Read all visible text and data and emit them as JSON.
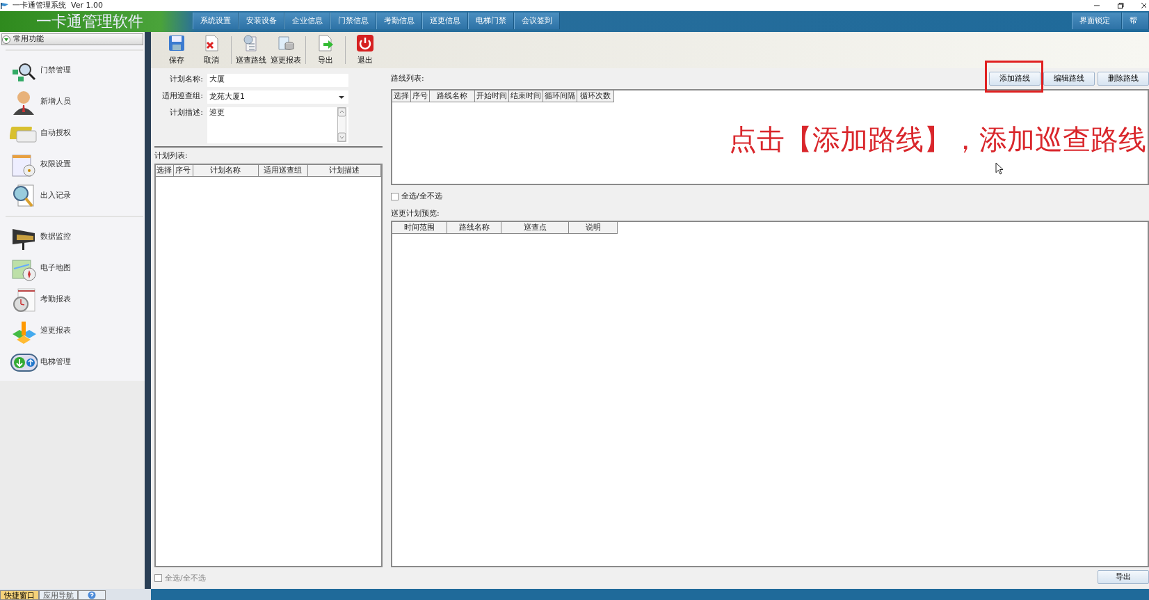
{
  "window": {
    "title": "一卡通管理系统  Ver 1.00"
  },
  "header": {
    "app_name": "一卡通管理软件",
    "menu": [
      "系统设置",
      "安装设备",
      "企业信息",
      "门禁信息",
      "考勤信息",
      "巡更信息",
      "电梯门禁",
      "会议签到"
    ],
    "right_menu": [
      "界面锁定",
      "帮"
    ]
  },
  "sidebar": {
    "title": "常用功能",
    "groups": [
      [
        "门禁管理",
        "新增人员",
        "自动授权",
        "权限设置",
        "出入记录"
      ],
      [
        "数据监控",
        "电子地图",
        "考勤报表",
        "巡更报表",
        "电梯管理"
      ]
    ]
  },
  "toolbar": [
    [
      "保存",
      "取消"
    ],
    [
      "巡查路线",
      "巡更报表"
    ],
    [
      "导出"
    ],
    [
      "退出"
    ]
  ],
  "form": [
    {
      "kind": "text",
      "label": "计划名称:",
      "value": "大厦"
    },
    {
      "kind": "select",
      "label": "适用巡查组:",
      "value": "龙苑大厦1"
    },
    {
      "kind": "textarea",
      "label": "计划描述:",
      "value": "巡更"
    }
  ],
  "plan_list": {
    "label": "计划列表:",
    "columns": [
      "选择",
      "序号",
      "计划名称",
      "适用巡查组",
      "计划描述"
    ],
    "select_all": {
      "label": "全选/全不选",
      "checked": false
    }
  },
  "route_list": {
    "label": "路线列表:",
    "buttons": [
      {
        "label": "添加路线",
        "highlighted": true
      },
      {
        "label": "编辑路线",
        "highlighted": false
      },
      {
        "label": "删除路线",
        "highlighted": false
      }
    ],
    "columns": [
      "选择",
      "序号",
      "路线名称",
      "开始时间",
      "结束时间",
      "循环间隔",
      "循环次数"
    ],
    "select_all": {
      "label": "全选/全不选",
      "checked": false
    }
  },
  "preview": {
    "label": "巡更计划预览:",
    "columns": [
      "时间范围",
      "路线名称",
      "巡查点",
      "说明"
    ]
  },
  "export_button": "导出",
  "annotation": "点击【添加路线】，添加巡查路线",
  "bottom_tabs": [
    {
      "label": "快捷窗口",
      "selected": true
    },
    {
      "label": "应用导航",
      "selected": false
    }
  ]
}
